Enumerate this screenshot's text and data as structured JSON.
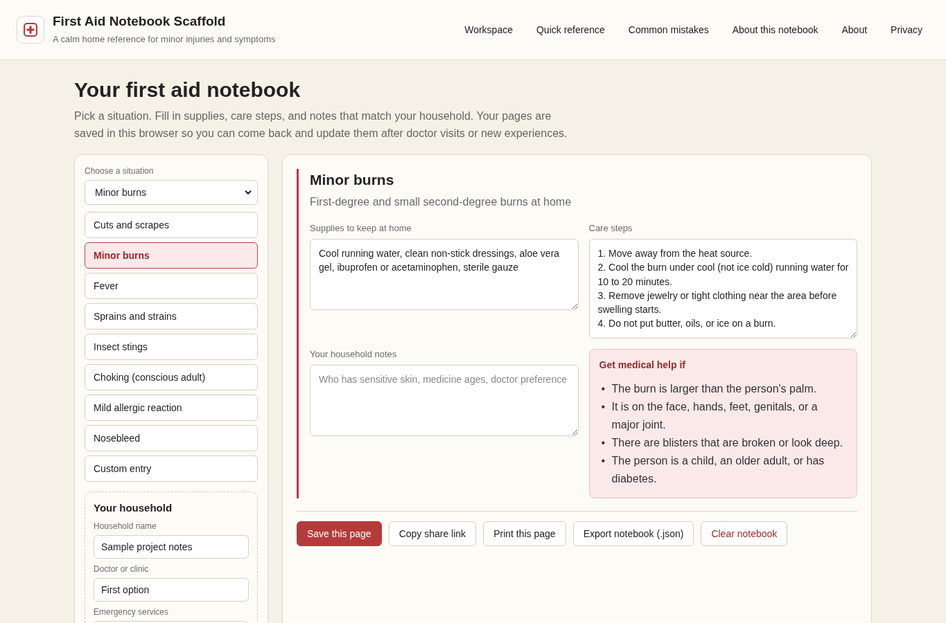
{
  "header": {
    "title": "First Aid Notebook Scaffold",
    "subtitle": "A calm home reference for minor injuries and symptoms",
    "nav": [
      "Workspace",
      "Quick reference",
      "Common mistakes",
      "About this notebook",
      "About",
      "Privacy"
    ]
  },
  "intro": {
    "title": "Your first aid notebook",
    "text": "Pick a situation. Fill in supplies, care steps, and notes that match your household. Your pages are saved in this browser so you can come back and update them after doctor visits or new experiences."
  },
  "sidebar": {
    "select": {
      "label": "Choose a situation",
      "value": "Minor burns"
    },
    "situations": [
      {
        "label": "Cuts and scrapes",
        "selected": false
      },
      {
        "label": "Minor burns",
        "selected": true
      },
      {
        "label": "Fever",
        "selected": false
      },
      {
        "label": "Sprains and strains",
        "selected": false
      },
      {
        "label": "Insect stings",
        "selected": false
      },
      {
        "label": "Choking (conscious adult)",
        "selected": false
      },
      {
        "label": "Mild allergic reaction",
        "selected": false
      },
      {
        "label": "Nosebleed",
        "selected": false
      },
      {
        "label": "Custom entry",
        "selected": false
      }
    ],
    "household": {
      "title": "Your household",
      "fields": [
        {
          "label": "Household name",
          "value": "Sample project notes"
        },
        {
          "label": "Doctor or clinic",
          "value": "First option"
        },
        {
          "label": "Emergency services"
        }
      ]
    }
  },
  "page": {
    "title": "Minor burns",
    "subtitle": "First-degree and small second-degree burns at home",
    "supplies": {
      "label": "Supplies to keep at home",
      "value": "Cool running water, clean non-stick dressings, aloe vera gel, ibuprofen or acetaminophen, sterile gauze"
    },
    "care_steps": {
      "label": "Care steps",
      "value": "1. Move away from the heat source.\n2. Cool the burn under cool (not ice cold) running water for 10 to 20 minutes.\n3. Remove jewelry or tight clothing near the area before swelling starts.\n4. Do not put butter, oils, or ice on a burn."
    },
    "notes": {
      "label": "Your household notes",
      "placeholder": "Who has sensitive skin, medicine ages, doctor preference"
    },
    "medical_help": {
      "title": "Get medical help if",
      "items": [
        {
          "marker": "•",
          "text": "The burn is larger than the person's palm."
        },
        {
          "marker": "•",
          "text": "It is on the face, hands, feet, genitals, or a major joint."
        },
        {
          "marker": "•",
          "text": "There are blisters that are broken or look deep."
        },
        {
          "marker": "•",
          "text": "The person is a child, an older adult, or has diabetes."
        }
      ]
    },
    "actions": [
      {
        "label": "Save this page",
        "kind": "primary"
      },
      {
        "label": "Copy share link",
        "kind": "secondary"
      },
      {
        "label": "Print this page",
        "kind": "secondary"
      },
      {
        "label": "Export notebook (.json)",
        "kind": "secondary"
      },
      {
        "label": "Clear notebook",
        "kind": "danger"
      }
    ]
  }
}
